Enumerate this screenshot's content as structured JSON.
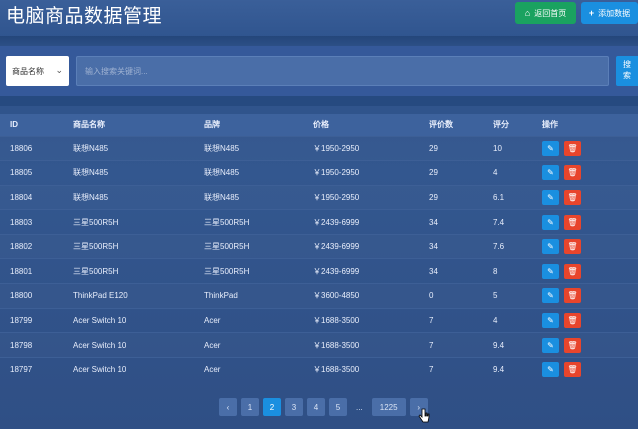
{
  "header": {
    "title": "电脑商品数据管理",
    "home_label": "返回首页",
    "home_icon": "home-icon",
    "add_label": "添加数据",
    "add_icon": "plus-icon"
  },
  "search": {
    "field_select": "商品名称",
    "placeholder": "输入搜索关键词...",
    "button_label": "搜索"
  },
  "table": {
    "columns": [
      "ID",
      "商品名称",
      "品牌",
      "价格",
      "评价数",
      "评分",
      "操作"
    ],
    "rows": [
      [
        "18806",
        "联想N485",
        "联想N485",
        "￥1950-2950",
        "29",
        "10"
      ],
      [
        "18805",
        "联想N485",
        "联想N485",
        "￥1950-2950",
        "29",
        "4"
      ],
      [
        "18804",
        "联想N485",
        "联想N485",
        "￥1950-2950",
        "29",
        "6.1"
      ],
      [
        "18803",
        "三星500R5H",
        "三星500R5H",
        "￥2439-6999",
        "34",
        "7.4"
      ],
      [
        "18802",
        "三星500R5H",
        "三星500R5H",
        "￥2439-6999",
        "34",
        "7.6"
      ],
      [
        "18801",
        "三星500R5H",
        "三星500R5H",
        "￥2439-6999",
        "34",
        "8"
      ],
      [
        "18800",
        "ThinkPad E120",
        "ThinkPad",
        "￥3600-4850",
        "0",
        "5"
      ],
      [
        "18799",
        "Acer Switch 10",
        "Acer",
        "￥1688-3500",
        "7",
        "4"
      ],
      [
        "18798",
        "Acer Switch 10",
        "Acer",
        "￥1688-3500",
        "7",
        "9.4"
      ],
      [
        "18797",
        "Acer Switch 10",
        "Acer",
        "￥1688-3500",
        "7",
        "9.4"
      ]
    ],
    "edit_icon": "edit-icon",
    "delete_icon": "trash-icon"
  },
  "pagination": {
    "prev": "‹",
    "pages": [
      "1",
      "2",
      "3",
      "4",
      "5"
    ],
    "active": "2",
    "ellipsis": "...",
    "last": "1225",
    "next": "›"
  },
  "colors": {
    "accent": "#1a8fe0",
    "success": "#1aa260",
    "danger": "#e8452c"
  }
}
